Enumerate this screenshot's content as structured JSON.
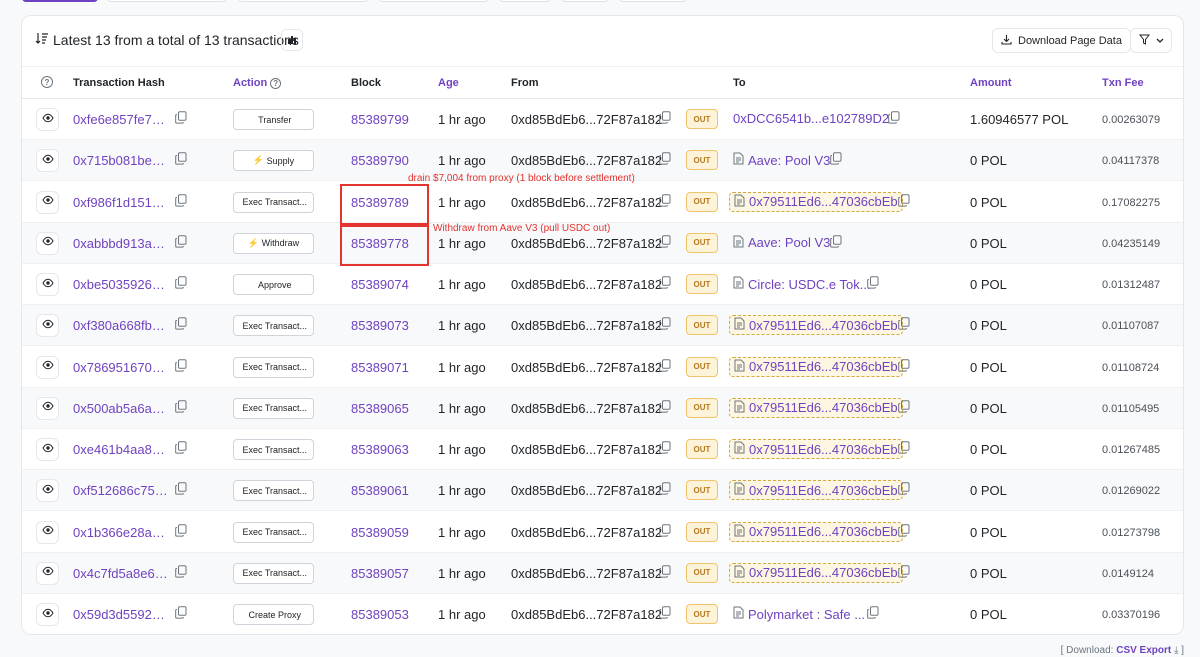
{
  "header": {
    "summary": "Latest 13 from a total of 13 transactions",
    "download_label": "Download Page Data"
  },
  "columns": {
    "txhash": "Transaction Hash",
    "action": "Action",
    "block": "Block",
    "age": "Age",
    "from": "From",
    "to": "To",
    "amount": "Amount",
    "fee": "Txn Fee"
  },
  "rows": [
    {
      "hash": "0xfe6e857fe79...",
      "action": "Transfer",
      "action_icon": "",
      "block": "85389799",
      "age": "1 hr ago",
      "from": "0xd85BdEb6...72F87a182",
      "dir": "OUT",
      "to": "0xDCC6541b...e102789D2",
      "to_type": "address",
      "amount": "1.60946577 POL",
      "fee": "0.00263079"
    },
    {
      "hash": "0x715b081be5...",
      "action": "Supply",
      "action_icon": "⚡",
      "block": "85389790",
      "age": "1 hr ago",
      "from": "0xd85BdEb6...72F87a182",
      "dir": "OUT",
      "to": "Aave: Pool V3",
      "to_type": "doc",
      "amount": "0 POL",
      "fee": "0.04117378"
    },
    {
      "hash": "0xf986f1d1519...",
      "action": "Exec Transact...",
      "action_icon": "",
      "block": "85389789",
      "age": "1 hr ago",
      "from": "0xd85BdEb6...72F87a182",
      "dir": "OUT",
      "to": "0x79511Ed6...47036cbEb",
      "to_type": "contract",
      "amount": "0 POL",
      "fee": "0.17082275"
    },
    {
      "hash": "0xabbbd913a8...",
      "action": "Withdraw",
      "action_icon": "⚡",
      "block": "85389778",
      "age": "1 hr ago",
      "from": "0xd85BdEb6...72F87a182",
      "dir": "OUT",
      "to": "Aave: Pool V3",
      "to_type": "doc",
      "amount": "0 POL",
      "fee": "0.04235149"
    },
    {
      "hash": "0xbe5035926b...",
      "action": "Approve",
      "action_icon": "",
      "block": "85389074",
      "age": "1 hr ago",
      "from": "0xd85BdEb6...72F87a182",
      "dir": "OUT",
      "to": "Circle: USDC.e Tok...",
      "to_type": "doc",
      "amount": "0 POL",
      "fee": "0.01312487"
    },
    {
      "hash": "0xf380a668fb9...",
      "action": "Exec Transact...",
      "action_icon": "",
      "block": "85389073",
      "age": "1 hr ago",
      "from": "0xd85BdEb6...72F87a182",
      "dir": "OUT",
      "to": "0x79511Ed6...47036cbEb",
      "to_type": "contract",
      "amount": "0 POL",
      "fee": "0.01107087"
    },
    {
      "hash": "0x786951670d...",
      "action": "Exec Transact...",
      "action_icon": "",
      "block": "85389071",
      "age": "1 hr ago",
      "from": "0xd85BdEb6...72F87a182",
      "dir": "OUT",
      "to": "0x79511Ed6...47036cbEb",
      "to_type": "contract",
      "amount": "0 POL",
      "fee": "0.01108724"
    },
    {
      "hash": "0x500ab5a6a1...",
      "action": "Exec Transact...",
      "action_icon": "",
      "block": "85389065",
      "age": "1 hr ago",
      "from": "0xd85BdEb6...72F87a182",
      "dir": "OUT",
      "to": "0x79511Ed6...47036cbEb",
      "to_type": "contract",
      "amount": "0 POL",
      "fee": "0.01105495"
    },
    {
      "hash": "0xe461b4aa80...",
      "action": "Exec Transact...",
      "action_icon": "",
      "block": "85389063",
      "age": "1 hr ago",
      "from": "0xd85BdEb6...72F87a182",
      "dir": "OUT",
      "to": "0x79511Ed6...47036cbEb",
      "to_type": "contract",
      "amount": "0 POL",
      "fee": "0.01267485"
    },
    {
      "hash": "0xf512686c759...",
      "action": "Exec Transact...",
      "action_icon": "",
      "block": "85389061",
      "age": "1 hr ago",
      "from": "0xd85BdEb6...72F87a182",
      "dir": "OUT",
      "to": "0x79511Ed6...47036cbEb",
      "to_type": "contract",
      "amount": "0 POL",
      "fee": "0.01269022"
    },
    {
      "hash": "0x1b366e28ab...",
      "action": "Exec Transact...",
      "action_icon": "",
      "block": "85389059",
      "age": "1 hr ago",
      "from": "0xd85BdEb6...72F87a182",
      "dir": "OUT",
      "to": "0x79511Ed6...47036cbEb",
      "to_type": "contract",
      "amount": "0 POL",
      "fee": "0.01273798"
    },
    {
      "hash": "0x4c7fd5a8e64...",
      "action": "Exec Transact...",
      "action_icon": "",
      "block": "85389057",
      "age": "1 hr ago",
      "from": "0xd85BdEb6...72F87a182",
      "dir": "OUT",
      "to": "0x79511Ed6...47036cbEb",
      "to_type": "contract",
      "amount": "0 POL",
      "fee": "0.0149124"
    },
    {
      "hash": "0x59d3d55928...",
      "action": "Create Proxy",
      "action_icon": "",
      "block": "85389053",
      "age": "1 hr ago",
      "from": "0xd85BdEb6...72F87a182",
      "dir": "OUT",
      "to": "Polymarket : Safe ...",
      "to_type": "doc",
      "amount": "0 POL",
      "fee": "0.03370196"
    }
  ],
  "annotations": [
    {
      "text": "drain $7,004 from proxy (1 block before settlement)",
      "row": 2
    },
    {
      "text": "Withdraw from Aave V3 (pull USDC out)",
      "row": 3
    }
  ],
  "footer": {
    "prefix": "[ Download: ",
    "link": "CSV Export",
    "suffix": " ⤓ ]"
  },
  "colors": {
    "accent": "#6f42c1",
    "annotation": "#e3342f",
    "out_badge_bg": "#fdf3d8"
  }
}
